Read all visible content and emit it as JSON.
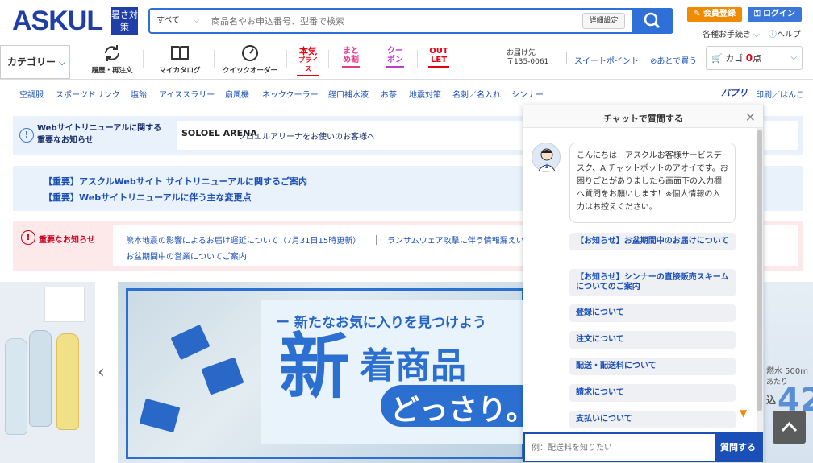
{
  "header": {
    "logo": "ASKUL",
    "badge": "暑さ対策",
    "search": {
      "category": "すべて",
      "placeholder": "商品名やお申込番号、型番で検索",
      "advanced": "詳細設定"
    },
    "member_register": "会員登録",
    "login": "ログイン",
    "procedures": "各種お手続き",
    "help": "ヘルプ"
  },
  "nav": {
    "category": "カテゴリー",
    "items": [
      {
        "label": "履歴・再注文"
      },
      {
        "label": "マイカタログ"
      },
      {
        "label": "クイックオーダー"
      }
    ],
    "promos": [
      {
        "line1": "本気",
        "line2": "プライス",
        "color": "#e60012"
      },
      {
        "line1": "まと",
        "line2": "め割",
        "color": "#e83a8c"
      },
      {
        "line1": "クー",
        "line2": "ポン",
        "color": "#c23ad1"
      },
      {
        "line1": "OUT",
        "line2": "LET",
        "color": "#e60012"
      }
    ],
    "delivery_label": "お届け先",
    "delivery_zip": "〒135-0061",
    "sweet_point": "スイートポイント",
    "later": "あとで買う",
    "cart_label": "カゴ",
    "cart_count": "0",
    "cart_unit": "点"
  },
  "keywords": [
    "空調服",
    "スポーツドリンク",
    "塩飴",
    "アイススラリー",
    "扇風機",
    "ネッククーラー",
    "経口補水液",
    "お茶",
    "地震対策",
    "名刺／名入れ",
    "シンナー"
  ],
  "keyword_right": {
    "papuri": "パプリ",
    "print": "印刷／はんこ"
  },
  "notice1": {
    "title_l1": "Webサイトリニューアルに関する",
    "title_l2": "重要なお知らせ",
    "brand": "SOLOEL ARENA",
    "text": "ソロエルアリーナをお使いのお客様へ"
  },
  "notice2": {
    "l1": "【重要】アスクルWebサイト サイトリニューアルに関するご案内",
    "l2": "【重要】Webサイトリニューアルに伴う主な変更点"
  },
  "notice3": {
    "title": "重要なお知らせ",
    "a1": "熊本地震の影響によるお届け遅延について（7月31日15時更新）",
    "a2": "ランサムウェア攻撃に伴う情報漏えい",
    "a3": "お盆期間中の営業についてご案内"
  },
  "banner": {
    "sub": "ー 新たなお気に入りを見つけよう",
    "big": "新",
    "mid": "着商品",
    "pill": "どっさり。"
  },
  "banner_right": {
    "t1": "燃水 500m",
    "t2": "あたり",
    "t3": "込",
    "t4": "42"
  },
  "chat": {
    "title": "チャットで質問する",
    "message": "こんにちは！アスクルお客様サービスデスク、AIチャットボットのアオイです。お困りごとがありましたら画面下の入力欄へ質問をお願いします！※個人情報の入力はお控えください。",
    "options": [
      "【お知らせ】お盆期間中のお届けについて",
      "【お知らせ】シンナーの直接販売スキームについてのご案内",
      "登録について",
      "注文について",
      "配送・配送料について",
      "請求について",
      "支払いについて"
    ],
    "input_placeholder": "例：配送料を知りたい",
    "send": "質問する"
  }
}
